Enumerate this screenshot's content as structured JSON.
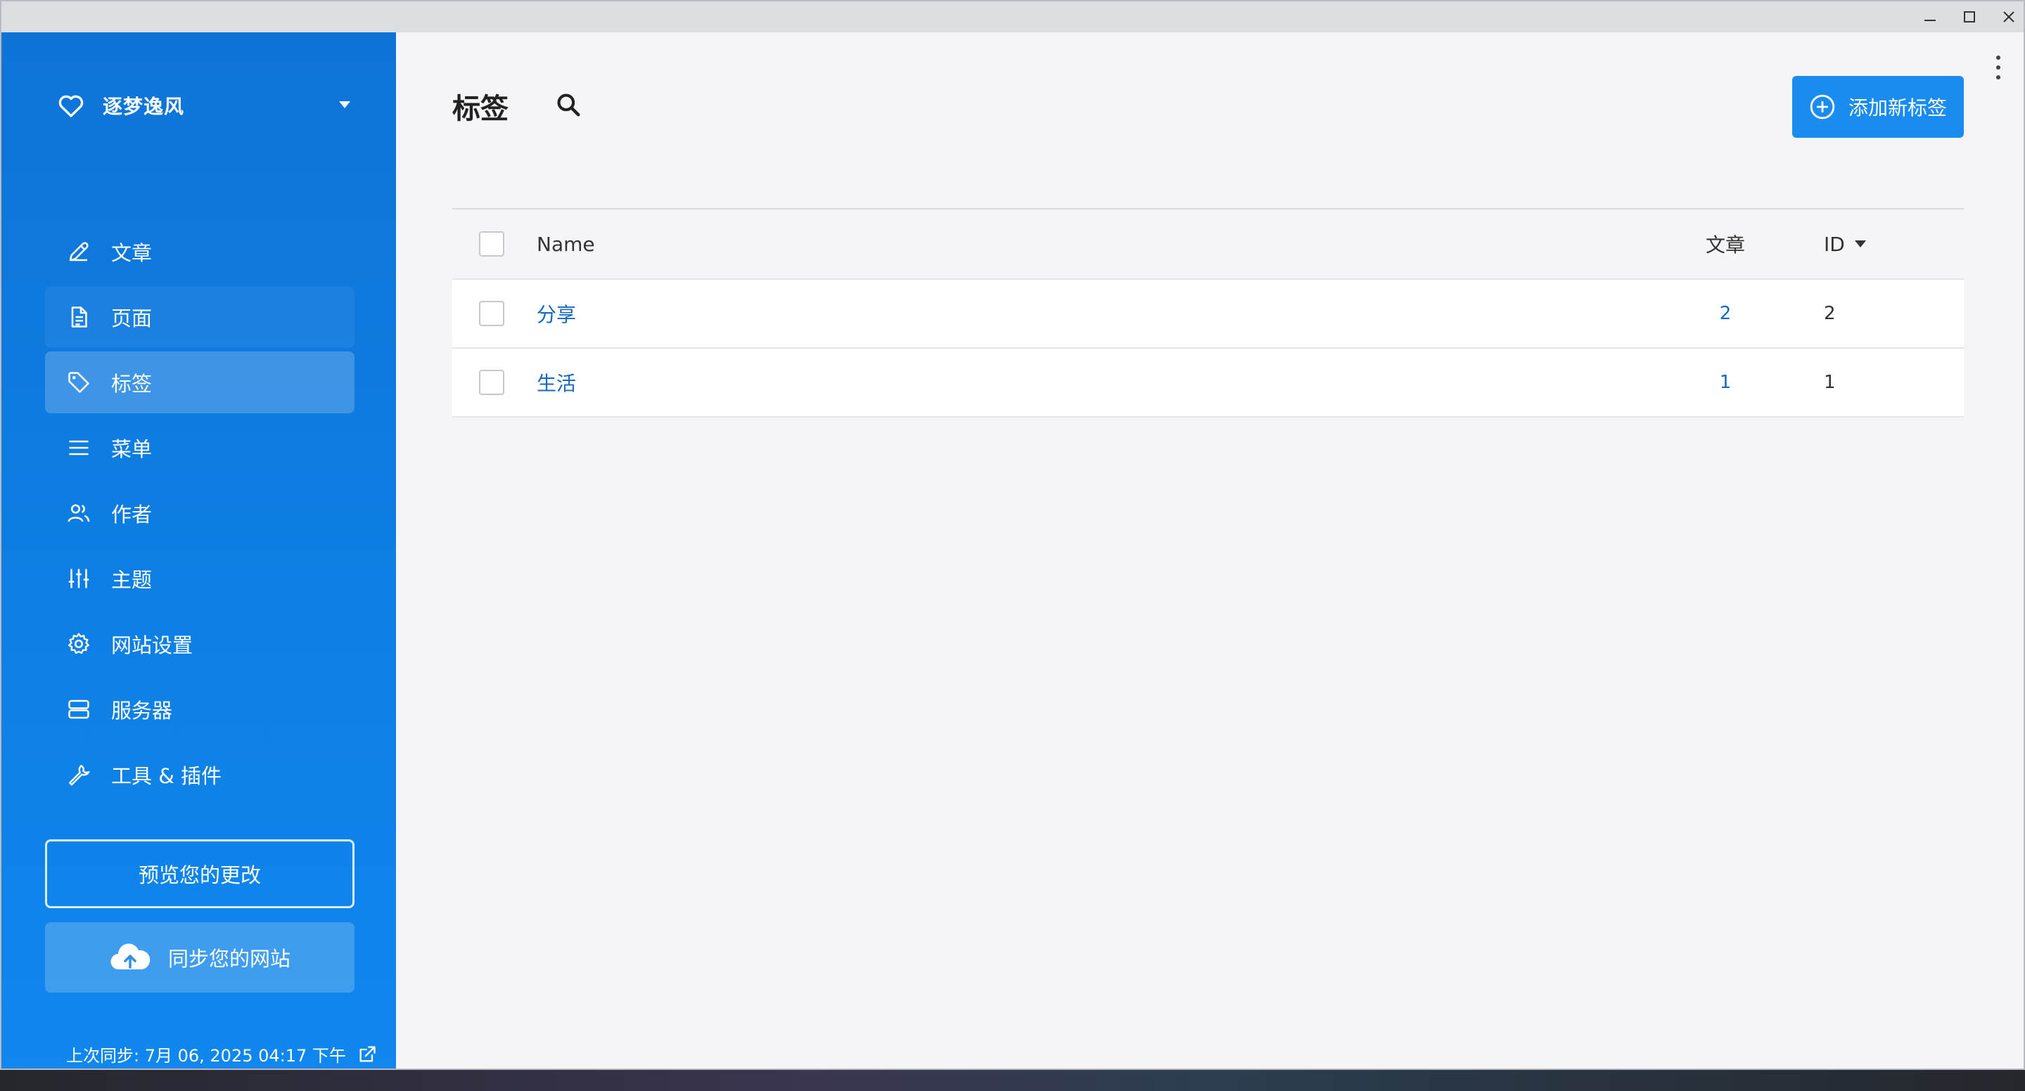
{
  "sidebar": {
    "brand": "逐梦逸风",
    "items": [
      {
        "label": "文章",
        "icon": "pencil-icon"
      },
      {
        "label": "页面",
        "icon": "document-icon"
      },
      {
        "label": "标签",
        "icon": "tag-icon"
      },
      {
        "label": "菜单",
        "icon": "menu-icon"
      },
      {
        "label": "作者",
        "icon": "users-icon"
      },
      {
        "label": "主题",
        "icon": "sliders-icon"
      },
      {
        "label": "网站设置",
        "icon": "gear-icon"
      },
      {
        "label": "服务器",
        "icon": "server-icon"
      },
      {
        "label": "工具 & 插件",
        "icon": "wrench-icon"
      }
    ],
    "active_index": 2,
    "preview_label": "预览您的更改",
    "sync_label": "同步您的网站",
    "last_sync": "上次同步: 7月 06, 2025 04:17 下午"
  },
  "main": {
    "title": "标签",
    "add_label": "添加新标签",
    "table": {
      "headers": {
        "name": "Name",
        "posts": "文章",
        "id": "ID"
      },
      "rows": [
        {
          "name": "分享",
          "posts": "2",
          "id": "2"
        },
        {
          "name": "生活",
          "posts": "1",
          "id": "1"
        }
      ]
    }
  },
  "colors": {
    "sidebar": "#0f7fe6",
    "accent": "#1a8cf0",
    "link": "#1668c5"
  }
}
